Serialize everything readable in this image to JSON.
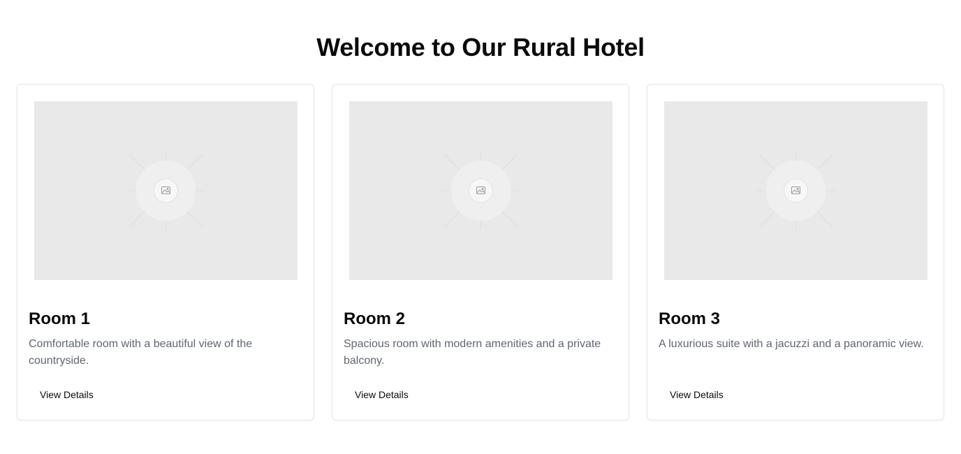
{
  "page": {
    "title": "Welcome to Our Rural Hotel"
  },
  "rooms": [
    {
      "title": "Room 1",
      "description": "Comfortable room with a beautiful view of the countryside.",
      "button_label": "View Details",
      "image_icon": "image-placeholder-icon"
    },
    {
      "title": "Room 2",
      "description": "Spacious room with modern amenities and a private balcony.",
      "button_label": "View Details",
      "image_icon": "image-placeholder-icon"
    },
    {
      "title": "Room 3",
      "description": "A luxurious suite with a jacuzzi and a panoramic view.",
      "button_label": "View Details",
      "image_icon": "image-placeholder-icon"
    }
  ],
  "colors": {
    "background": "#ffffff",
    "card_border": "#e4e4e7",
    "image_placeholder": "#e9e9e9",
    "title_text": "#0a0a0a",
    "description_text": "#5f6672"
  }
}
